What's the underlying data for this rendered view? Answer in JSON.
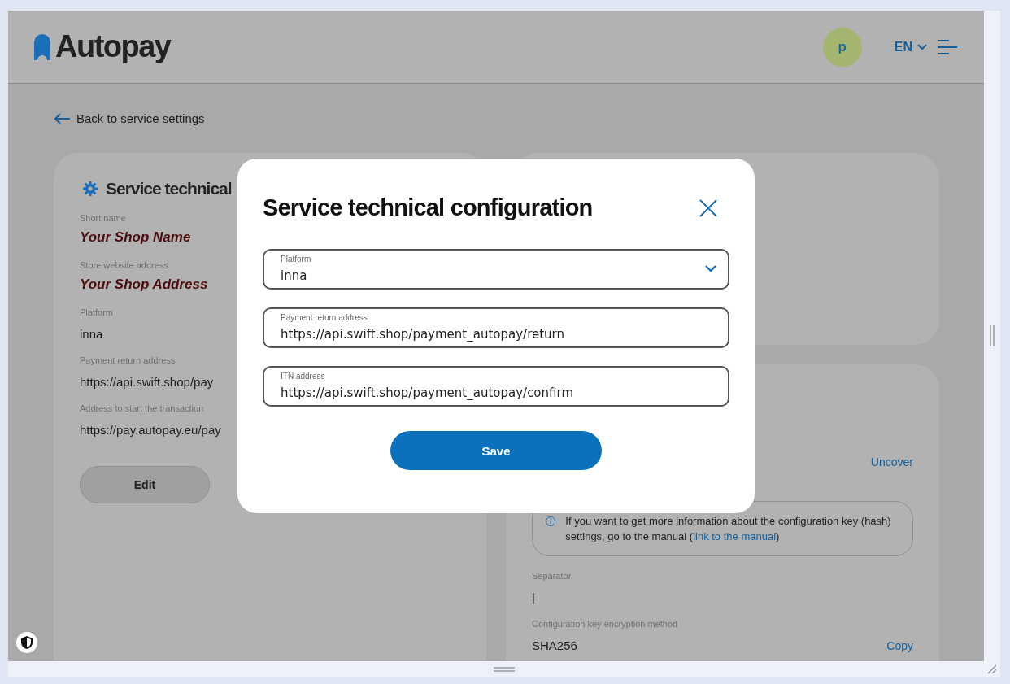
{
  "header": {
    "logo": "Autopay",
    "avatar": "p",
    "language": "EN"
  },
  "back_link": "Back to service settings",
  "config_card": {
    "title": "Service technical",
    "fields": [
      {
        "label": "Short name",
        "value": "Your Shop Name",
        "kind": "sample"
      },
      {
        "label": "Store website address",
        "value": "Your Shop Address",
        "kind": "sample"
      },
      {
        "label": "Platform",
        "value": "inna",
        "kind": "text"
      },
      {
        "label": "Payment return address",
        "value": "https://api.swift.shop/pay",
        "kind": "text"
      },
      {
        "label": "Address to start the transaction",
        "value": "https://pay.autopay.eu/pay",
        "kind": "text"
      }
    ],
    "edit_button": "Edit"
  },
  "keys_card": {
    "uncover_link": "Uncover",
    "info": {
      "text": "If you want to get more information about the configuration key (hash) settings, go to the manual (",
      "link": "link to the manual",
      "text_end": ")"
    },
    "fields": [
      {
        "label": "Separator",
        "value": "|"
      },
      {
        "label": "Configuration key encryption method",
        "value": "SHA256",
        "action": "Copy"
      }
    ]
  },
  "modal": {
    "title": "Service technical configuration",
    "fields": [
      {
        "label": "Platform",
        "value": "inna",
        "kind": "select"
      },
      {
        "label": "Payment return address",
        "value": "https://api.swift.shop/payment_autopay/return",
        "kind": "text"
      },
      {
        "label": "ITN address",
        "value": "https://api.swift.shop/payment_autopay/confirm",
        "kind": "text"
      }
    ],
    "save_button": "Save"
  }
}
